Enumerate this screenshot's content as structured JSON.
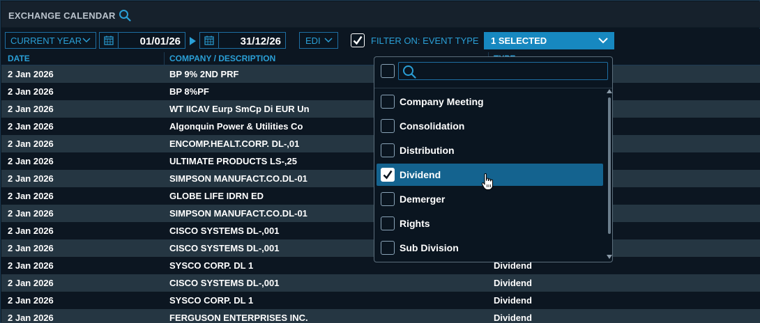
{
  "title": "EXCHANGE CALENDAR",
  "icons": {
    "search": "search-icon",
    "calendar": "calendar-icon",
    "chevron": "chevron-down-icon",
    "check": "checkmark-icon",
    "cursor": "hand-pointer-icon"
  },
  "colors": {
    "accent": "#2a9fd6",
    "selected_bg": "#1788c0",
    "row_even": "#253642",
    "row_odd": "#0c1621",
    "option_selected": "#14638f"
  },
  "toolbar": {
    "period": "CURRENT YEAR",
    "date_from": "01/01/26",
    "date_to": "31/12/26",
    "source": "EDI",
    "filter_checked": true,
    "filter_label": "FILTER ON: EVENT TYPE",
    "selection": "1 SELECTED"
  },
  "table": {
    "headers": {
      "date": "DATE",
      "company": "COMPANY / DESCRIPTION",
      "type": "TYPE"
    },
    "rows": [
      {
        "date": "2 Jan 2026",
        "company": "BP 9% 2ND PRF",
        "type": ""
      },
      {
        "date": "2 Jan 2026",
        "company": "BP 8%PF",
        "type": ""
      },
      {
        "date": "2 Jan 2026",
        "company": "WT IICAV Eurp SmCp Di EUR Un",
        "type": ""
      },
      {
        "date": "2 Jan 2026",
        "company": "Algonquin Power & Utilities Co",
        "type": ""
      },
      {
        "date": "2 Jan 2026",
        "company": "ENCOMP.HEALT.CORP. DL-,01",
        "type": ""
      },
      {
        "date": "2 Jan 2026",
        "company": "ULTIMATE PRODUCTS LS-,25",
        "type": ""
      },
      {
        "date": "2 Jan 2026",
        "company": "SIMPSON MANUFACT.CO.DL-01",
        "type": ""
      },
      {
        "date": "2 Jan 2026",
        "company": "GLOBE LIFE IDRN ED",
        "type": ""
      },
      {
        "date": "2 Jan 2026",
        "company": "SIMPSON MANUFACT.CO.DL-01",
        "type": ""
      },
      {
        "date": "2 Jan 2026",
        "company": "CISCO SYSTEMS DL-,001",
        "type": ""
      },
      {
        "date": "2 Jan 2026",
        "company": "CISCO SYSTEMS DL-,001",
        "type": ""
      },
      {
        "date": "2 Jan 2026",
        "company": "SYSCO CORP. DL 1",
        "type": "Dividend"
      },
      {
        "date": "2 Jan 2026",
        "company": "CISCO SYSTEMS DL-,001",
        "type": "Dividend"
      },
      {
        "date": "2 Jan 2026",
        "company": "SYSCO CORP. DL 1",
        "type": "Dividend"
      },
      {
        "date": "2 Jan 2026",
        "company": "FERGUSON ENTERPRISES INC.",
        "type": "Dividend"
      }
    ]
  },
  "dropdown": {
    "search_value": "",
    "options": [
      {
        "label": "Company Meeting",
        "checked": false
      },
      {
        "label": "Consolidation",
        "checked": false
      },
      {
        "label": "Distribution",
        "checked": false
      },
      {
        "label": "Dividend",
        "checked": true
      },
      {
        "label": "Demerger",
        "checked": false
      },
      {
        "label": "Rights",
        "checked": false
      },
      {
        "label": "Sub Division",
        "checked": false
      }
    ]
  }
}
